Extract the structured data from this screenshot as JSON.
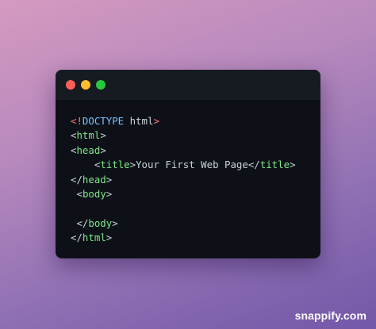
{
  "colors": {
    "tag": "#7ee787",
    "bracket": "#c9d1d9",
    "text": "#c9d1d9",
    "doctype_punct": "#ff7b72",
    "doctype_keyword": "#79c0ff",
    "dot_red": "#ff5f57",
    "dot_yellow": "#febc2e",
    "dot_green": "#28c840"
  },
  "window": {
    "controls": [
      "close-dot",
      "minimize-dot",
      "maximize-dot"
    ]
  },
  "code": {
    "lines": [
      [
        {
          "text": "<!",
          "type": "doctype_punct"
        },
        {
          "text": "DOCTYPE",
          "type": "doctype_keyword"
        },
        {
          "text": " html",
          "type": "text"
        },
        {
          "text": ">",
          "type": "doctype_punct"
        }
      ],
      [
        {
          "text": "<",
          "type": "bracket"
        },
        {
          "text": "html",
          "type": "tag"
        },
        {
          "text": ">",
          "type": "bracket"
        }
      ],
      [
        {
          "text": "<",
          "type": "bracket"
        },
        {
          "text": "head",
          "type": "tag"
        },
        {
          "text": ">",
          "type": "bracket"
        }
      ],
      [
        {
          "text": "    ",
          "type": "text"
        },
        {
          "text": "<",
          "type": "bracket"
        },
        {
          "text": "title",
          "type": "tag"
        },
        {
          "text": ">",
          "type": "bracket"
        },
        {
          "text": "Your First Web Page",
          "type": "text"
        },
        {
          "text": "</",
          "type": "bracket"
        },
        {
          "text": "title",
          "type": "tag"
        },
        {
          "text": ">",
          "type": "bracket"
        }
      ],
      [
        {
          "text": "</",
          "type": "bracket"
        },
        {
          "text": "head",
          "type": "tag"
        },
        {
          "text": ">",
          "type": "bracket"
        }
      ],
      [
        {
          "text": " ",
          "type": "text"
        },
        {
          "text": "<",
          "type": "bracket"
        },
        {
          "text": "body",
          "type": "tag"
        },
        {
          "text": ">",
          "type": "bracket"
        }
      ],
      [],
      [
        {
          "text": " ",
          "type": "text"
        },
        {
          "text": "</",
          "type": "bracket"
        },
        {
          "text": "body",
          "type": "tag"
        },
        {
          "text": ">",
          "type": "bracket"
        }
      ],
      [
        {
          "text": "</",
          "type": "bracket"
        },
        {
          "text": "html",
          "type": "tag"
        },
        {
          "text": ">",
          "type": "bracket"
        }
      ]
    ]
  },
  "watermark": "snappify.com"
}
